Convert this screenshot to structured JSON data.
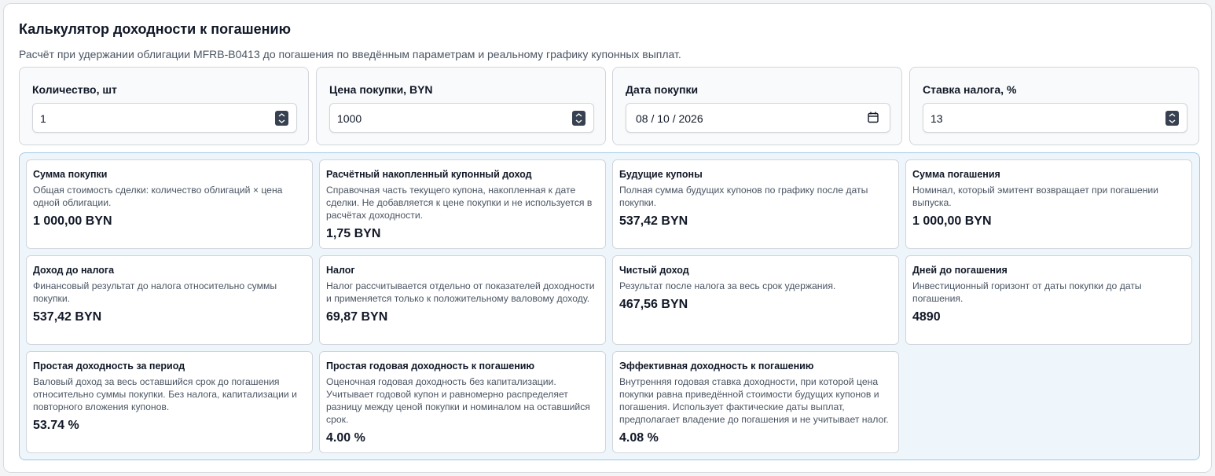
{
  "header": {
    "title": "Калькулятор доходности к погашению",
    "subtitle": "Расчёт при удержании облигации MFRB-B0413 до погашения по введённым параметрам и реальному графику купонных выплат."
  },
  "inputs": [
    {
      "label": "Количество, шт",
      "value": "1"
    },
    {
      "label": "Цена покупки, BYN",
      "value": "1000"
    },
    {
      "label": "Дата покупки",
      "value": "08 / 10 / 2026"
    },
    {
      "label": "Ставка налога, %",
      "value": "13"
    }
  ],
  "results": [
    {
      "title": "Сумма покупки",
      "desc": "Общая стоимость сделки: количество облигаций × цена одной облигации.",
      "value": "1 000,00 BYN"
    },
    {
      "title": "Расчётный накопленный купонный доход",
      "desc": "Справочная часть текущего купона, накопленная к дате сделки. Не добавляется к цене покупки и не используется в расчётах доходности.",
      "value": "1,75 BYN"
    },
    {
      "title": "Будущие купоны",
      "desc": "Полная сумма будущих купонов по графику после даты покупки.",
      "value": "537,42 BYN"
    },
    {
      "title": "Сумма погашения",
      "desc": "Номинал, который эмитент возвращает при погашении выпуска.",
      "value": "1 000,00 BYN"
    },
    {
      "title": "Доход до налога",
      "desc": "Финансовый результат до налога относительно суммы покупки.",
      "value": "537,42 BYN"
    },
    {
      "title": "Налог",
      "desc": "Налог рассчитывается отдельно от показателей доходности и применяется только к положительному валовому доходу.",
      "value": "69,87 BYN"
    },
    {
      "title": "Чистый доход",
      "desc": "Результат после налога за весь срок удержания.",
      "value": "467,56 BYN"
    },
    {
      "title": "Дней до погашения",
      "desc": "Инвестиционный горизонт от даты покупки до даты погашения.",
      "value": "4890"
    },
    {
      "title": "Простая доходность за период",
      "desc": "Валовый доход за весь оставшийся срок до погашения относительно суммы покупки. Без налога, капитализации и повторного вложения купонов.",
      "value": "53.74 %"
    },
    {
      "title": "Простая годовая доходность к погашению",
      "desc": "Оценочная годовая доходность без капитализации. Учитывает годовой купон и равномерно распределяет разницу между ценой покупки и номиналом на оставшийся срок.",
      "value": "4.00 %"
    },
    {
      "title": "Эффективная доходность к погашению",
      "desc": "Внутренняя годовая ставка доходности, при которой цена покупки равна приведённой стоимости будущих купонов и погашения. Использует фактические даты выплат, предполагает владение до погашения и не учитывает налог.",
      "value": "4.08 %"
    }
  ],
  "icons": {
    "spinner": "spinner-icon",
    "calendar": "calendar-icon"
  },
  "colors": {
    "results_bg": "#eff6fb",
    "results_border": "#9ec9e6"
  }
}
